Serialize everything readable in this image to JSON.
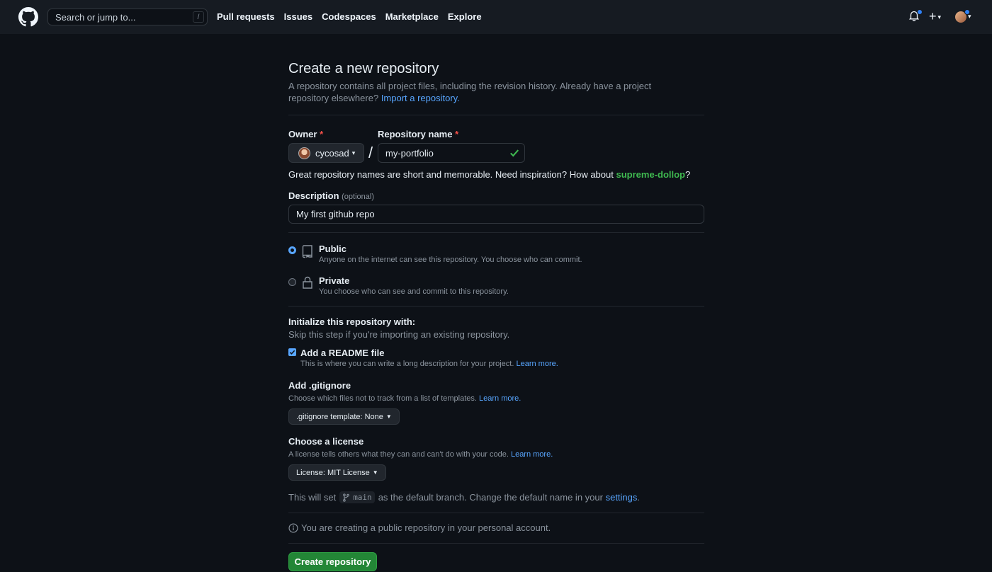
{
  "header": {
    "search_placeholder": "Search or jump to...",
    "search_shortcut": "/",
    "nav": [
      "Pull requests",
      "Issues",
      "Codespaces",
      "Marketplace",
      "Explore"
    ]
  },
  "page": {
    "title": "Create a new repository",
    "intro_text": "A repository contains all project files, including the revision history. Already have a project repository elsewhere?",
    "import_link": "Import a repository."
  },
  "owner": {
    "label": "Owner",
    "required_mark": "*",
    "value": "cycosad"
  },
  "repo": {
    "label": "Repository name",
    "required_mark": "*",
    "value": "my-portfolio",
    "separator": "/",
    "hint_prefix": "Great repository names are short and memorable. Need inspiration? How about",
    "suggestion": "supreme-dollop",
    "hint_suffix": "?"
  },
  "description": {
    "label": "Description",
    "optional": "(optional)",
    "value": "My first github repo"
  },
  "visibility": {
    "public_title": "Public",
    "public_sub": "Anyone on the internet can see this repository. You choose who can commit.",
    "private_title": "Private",
    "private_sub": "You choose who can see and commit to this repository.",
    "selected": "Public"
  },
  "init": {
    "title": "Initialize this repository with:",
    "sub": "Skip this step if you're importing an existing repository.",
    "readme_label": "Add a README file",
    "readme_checked": true,
    "readme_sub": "This is where you can write a long description for your project.",
    "learn_more": "Learn more."
  },
  "gitignore": {
    "label": "Add .gitignore",
    "sub": "Choose which files not to track from a list of templates.",
    "learn_more": "Learn more.",
    "button": ".gitignore template: None"
  },
  "license": {
    "label": "Choose a license",
    "sub": "A license tells others what they can and can't do with your code.",
    "learn_more": "Learn more.",
    "button": "License: MIT License"
  },
  "branch": {
    "prefix": "This will set",
    "name": "main",
    "middle": "as the default branch. Change the default name in your",
    "settings_link": "settings",
    "suffix": "."
  },
  "info": {
    "text": "You are creating a public repository in your personal account."
  },
  "submit": {
    "label": "Create repository"
  },
  "colors": {
    "background": "#0d1117",
    "header": "#161b22",
    "link": "#58a6ff",
    "success": "#3fb950",
    "primary_button": "#238636",
    "danger": "#f85149"
  }
}
